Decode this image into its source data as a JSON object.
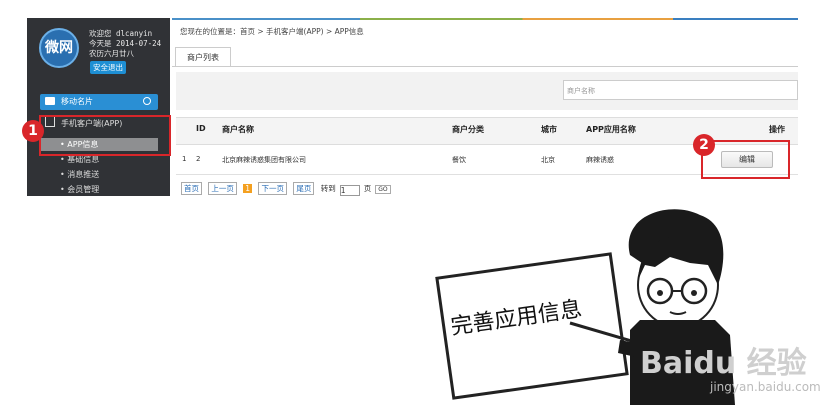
{
  "sidebar": {
    "logo_text": "微网",
    "welcome": "欢迎您 dlcanyin",
    "today": "今天是 2014-07-24",
    "lunar": "农历六月廿八",
    "logout": "安全退出",
    "menu_card": "移动名片",
    "menu_app": "手机客户端(APP)",
    "sub_items": [
      "APP信息",
      "基础信息",
      "消息推送",
      "会员管理"
    ]
  },
  "breadcrumb": "您现在的位置是：首页 > 手机客户端(APP) > APP信息",
  "tab": "商户列表",
  "search": {
    "placeholder": "商户名称"
  },
  "table": {
    "headers": [
      "ID",
      "商户名称",
      "商户分类",
      "城市",
      "APP应用名称",
      "操作"
    ],
    "row": {
      "index": "1",
      "id": "2",
      "name": "北京麻辣诱惑集团有限公司",
      "category": "餐饮",
      "city": "北京",
      "app": "麻辣诱惑",
      "action": "编辑"
    }
  },
  "pager": {
    "first": "首页",
    "prev": "上一页",
    "current": "1",
    "next": "下一页",
    "last": "尾页",
    "goto": "转到",
    "input": "1",
    "page": "页",
    "go": "GO"
  },
  "annotations": {
    "marker1": "1",
    "marker2": "2"
  },
  "illustration": {
    "board_text": "完善应用信息",
    "watermark": "Baidu 经验",
    "watermark_sub": "jingyan.baidu.com"
  },
  "colors": {
    "sidebar_bg": "#303236",
    "accent": "#2a8fd4",
    "highlight": "#d9262a"
  }
}
